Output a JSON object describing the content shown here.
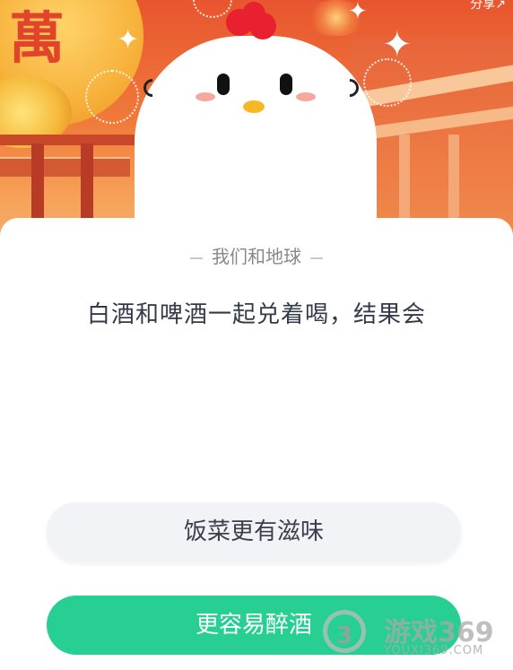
{
  "header": {
    "share_label": "分享"
  },
  "banner": {
    "lantern_char": "萬"
  },
  "quiz": {
    "category": "我们和地球",
    "question": "白酒和啤酒一起兑着喝，结果会",
    "options": [
      {
        "label": "饭菜更有滋味"
      },
      {
        "label": "更容易醉酒"
      }
    ]
  },
  "watermark": {
    "logo": "3",
    "text": "游戏369",
    "url": "YOUXI369.COM"
  },
  "colors": {
    "accent": "#27cf92",
    "banner": "#e8552f",
    "comb": "#e8202f"
  },
  "icons": [
    "share-icon",
    "mascot-chick-icon",
    "sparkle-icon"
  ]
}
